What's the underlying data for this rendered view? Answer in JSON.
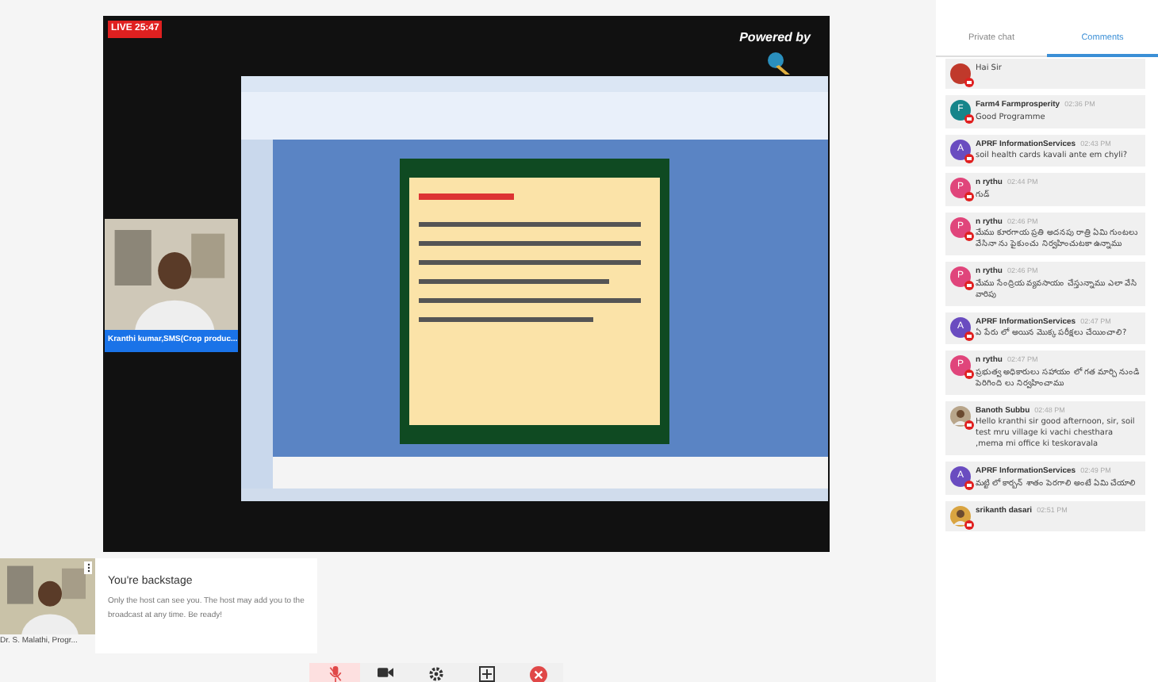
{
  "stage": {
    "live_badge": "LIVE 25:47",
    "powered_by": "Powered by",
    "presenter": {
      "name": "Kranthi kumar,SMS(Crop produc..."
    }
  },
  "backstage": {
    "guest": {
      "name": "Dr. S. Malathi, Progr..."
    },
    "title": "You're backstage",
    "message": "Only the host can see you. The host may add you to the broadcast at any time. Be ready!"
  },
  "toolbar": [
    {
      "kind": "mic",
      "muted": true
    },
    {
      "kind": "camera",
      "muted": false
    },
    {
      "kind": "settings",
      "muted": false
    },
    {
      "kind": "share",
      "muted": false
    },
    {
      "kind": "leave",
      "muted": false
    }
  ],
  "chat": {
    "tabs": [
      {
        "label": "Private chat",
        "selected": false
      },
      {
        "label": "Comments",
        "selected": true
      }
    ],
    "comments": [
      {
        "text": "Hai Sir",
        "kind": "letter",
        "color": "#c0392b"
      },
      {
        "name": "Farm4 Farmprosperity",
        "time": "02:36 PM",
        "text": "Good Programme",
        "avatar": "F",
        "kind": "letter",
        "color": "#16858a"
      },
      {
        "name": "APRF InformationServices",
        "time": "02:43 PM",
        "text": "soil health cards kavali ante em chyli?",
        "avatar": "A",
        "kind": "letter",
        "color": "#6a4cc0"
      },
      {
        "name": "n rythu",
        "time": "02:44 PM",
        "text": "గుడ్",
        "avatar": "P",
        "kind": "letter",
        "color": "#e0457b"
      },
      {
        "name": "n rythu",
        "time": "02:46 PM",
        "text": "మేము కూరగాయ ప్రతి అదనపు రాత్రి ఏమి గుంటలు వేసినా ను పైకుంచు నిర్వహించుటకా ఉన్నాము",
        "avatar": "P",
        "kind": "letter",
        "color": "#e0457b"
      },
      {
        "name": "n rythu",
        "time": "02:46 PM",
        "text": "మేము సేంద్రియ వ్యవసాయం చేస్తున్నాము ఎలా వేసి వారిపు",
        "avatar": "P",
        "kind": "letter",
        "color": "#e0457b"
      },
      {
        "name": "APRF InformationServices",
        "time": "02:47 PM",
        "text": "ఏ పేరు లో అయిన మొక్క పరీక్షలు చేయించాలి?",
        "avatar": "A",
        "kind": "letter",
        "color": "#6a4cc0"
      },
      {
        "name": "n rythu",
        "time": "02:47 PM",
        "text": "ప్రభుత్వ అధికారులు సహాయం లో గత మార్చి నుండి పెరిగింది లు నిర్వహించాము",
        "avatar": "P",
        "kind": "letter",
        "color": "#e0457b"
      },
      {
        "name": "Banoth Subbu",
        "time": "02:48 PM",
        "text": "Hello kranthi sir good afternoon, sir, soil test mru village ki vachi chesthara ,mema mi office ki teskoravala",
        "color": "#b8a58a"
      },
      {
        "name": "APRF InformationServices",
        "time": "02:49 PM",
        "text": "మట్టి లో కార్బన్ శాతం పెరగాలి అంటే ఏమి చేయాలి",
        "avatar": "A",
        "kind": "letter",
        "color": "#6a4cc0"
      },
      {
        "name": "srikanth dasari",
        "time": "02:51 PM",
        "color": "#d9a441"
      }
    ]
  }
}
